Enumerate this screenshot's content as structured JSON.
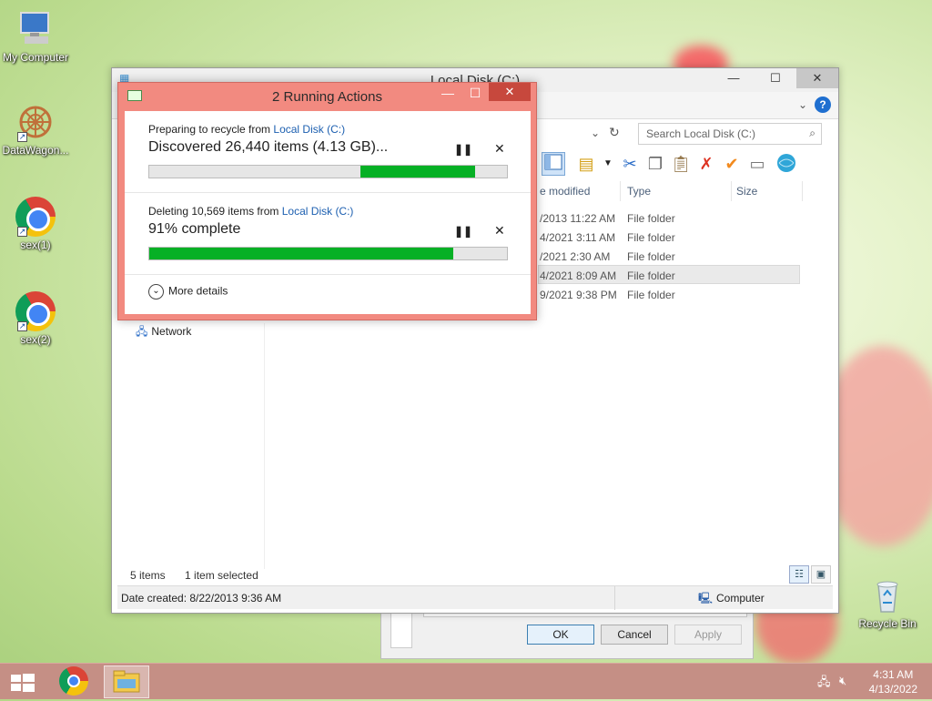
{
  "desktop": {
    "icons": [
      {
        "label": "My Computer",
        "icon": "computer-icon"
      },
      {
        "label": "DataWagon...",
        "icon": "datawagon-icon"
      },
      {
        "label": "sex(1)",
        "icon": "chrome-icon"
      },
      {
        "label": "sex(2)",
        "icon": "chrome-icon"
      },
      {
        "label": "Recycle Bin",
        "icon": "recycle-bin-icon"
      }
    ]
  },
  "explorer": {
    "title": "Local Disk (C:)",
    "search_placeholder": "Search Local Disk (C:)",
    "columns": [
      "e modified",
      "Type",
      "Size"
    ],
    "rows": [
      {
        "modified": "/2013 11:22 AM",
        "type": "File folder"
      },
      {
        "modified": "4/2021 3:11 AM",
        "type": "File folder"
      },
      {
        "modified": "/2021 2:30 AM",
        "type": "File folder"
      },
      {
        "modified": "4/2021 8:09 AM",
        "type": "File folder"
      },
      {
        "modified": "9/2021 9:38 PM",
        "type": "File folder"
      }
    ],
    "nav_network": "Network",
    "status_items": "5 items",
    "status_selected": "1 item selected",
    "details": "Date created: 8/22/2013 9:36 AM",
    "location": "Computer"
  },
  "properties_dialog": {
    "ok": "OK",
    "cancel": "Cancel",
    "apply": "Apply"
  },
  "running_actions": {
    "title": "2 Running Actions",
    "op1": {
      "prefix": "Preparing to recycle from ",
      "link": "Local Disk (C:)",
      "status": "Discovered 26,440 items (4.13 GB)...",
      "progress": {
        "start": 0.59,
        "end": 0.91
      }
    },
    "op2": {
      "prefix": "Deleting 10,569 items from ",
      "link": "Local Disk (C:)",
      "status": "91% complete",
      "progress": {
        "start": 0,
        "end": 0.85
      }
    },
    "more_details": "More details"
  },
  "taskbar": {
    "time": "4:31 AM",
    "date": "4/13/2022"
  },
  "colors": {
    "accent": "#f28a80",
    "progress": "#06b025",
    "link": "#1c5fb0",
    "taskbar": "#c58f85"
  }
}
